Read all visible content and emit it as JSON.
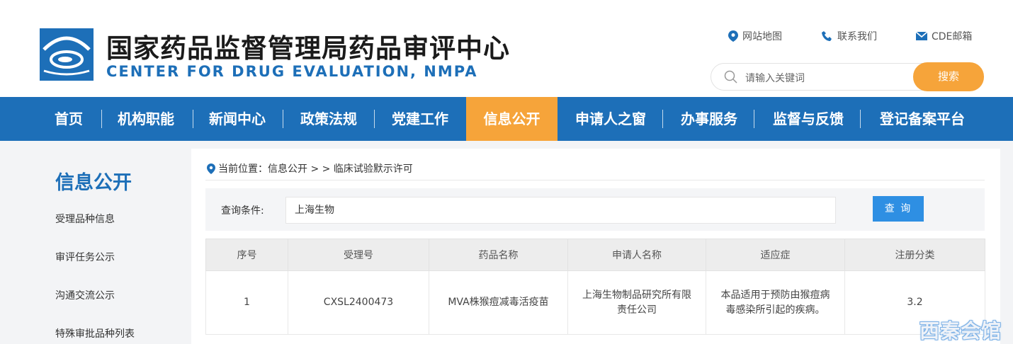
{
  "header": {
    "title": "国家药品监督管理局药品审评中心",
    "subtitle": "CENTER FOR DRUG EVALUATION, NMPA",
    "links": {
      "sitemap": "网站地图",
      "contact": "联系我们",
      "email": "CDE邮箱"
    },
    "search": {
      "placeholder": "请输入关键词",
      "button": "搜索"
    }
  },
  "nav": {
    "items": [
      "首页",
      "机构职能",
      "新闻中心",
      "政策法规",
      "党建工作",
      "信息公开",
      "申请人之窗",
      "办事服务",
      "监督与反馈",
      "登记备案平台"
    ],
    "active": "信息公开"
  },
  "sidebar": {
    "title": "信息公开",
    "items": [
      "受理品种信息",
      "审评任务公示",
      "沟通交流公示",
      "特殊审批品种列表"
    ]
  },
  "breadcrumb": {
    "text": "当前位置：信息公开 > > 临床试验默示许可"
  },
  "query": {
    "label": "查询条件:",
    "value": "上海生物",
    "button": "查 询"
  },
  "table": {
    "headers": [
      "序号",
      "受理号",
      "药品名称",
      "申请人名称",
      "适应症",
      "注册分类"
    ],
    "rows": [
      {
        "no": "1",
        "accept_no": "CXSL2400473",
        "drug": "MVA株猴痘减毒活疫苗",
        "applicant": "上海生物制品研究所有限责任公司",
        "indication": "本品适用于预防由猴痘病毒感染所引起的疾病。",
        "category": "3.2"
      }
    ]
  },
  "watermark": "西秦会馆",
  "colors": {
    "brand_blue": "#1d6fb8",
    "accent_orange": "#f6a43a",
    "query_button": "#2e8fe3"
  }
}
